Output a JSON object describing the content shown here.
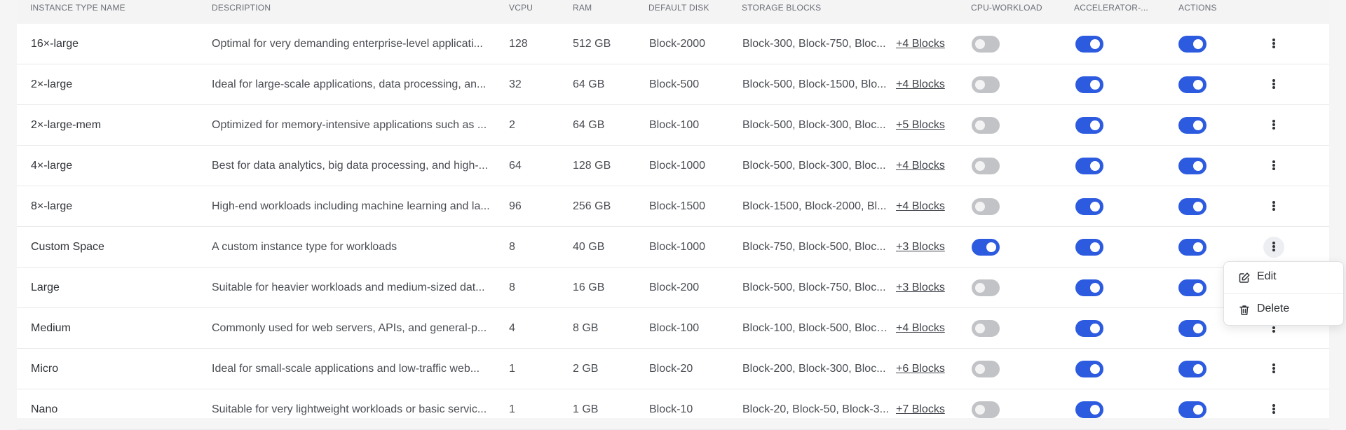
{
  "table": {
    "headers": {
      "name": "INSTANCE TYPE NAME",
      "description": "DESCRIPTION",
      "vcpu": "VCPU",
      "ram": "RAM",
      "default_disk": "DEFAULT DISK",
      "storage_blocks": "STORAGE BLOCKS",
      "cpu_workload": "CPU-WORKLOAD",
      "accelerator": "ACCELERATOR-...",
      "actions": "ACTIONS"
    },
    "rows": [
      {
        "name": "16×-large",
        "description": "Optimal for very demanding enterprise-level applicati...",
        "vcpu": "128",
        "ram": "512 GB",
        "disk": "Block-2000",
        "blocks": "Block-300, Block-750, Bloc...",
        "more": "+4 Blocks",
        "cpu": false,
        "acc": true,
        "act": true
      },
      {
        "name": "2×-large",
        "description": "Ideal for large-scale applications, data processing, an...",
        "vcpu": "32",
        "ram": "64 GB",
        "disk": "Block-500",
        "blocks": "Block-500, Block-1500, Blo...",
        "more": "+4 Blocks",
        "cpu": false,
        "acc": true,
        "act": true
      },
      {
        "name": "2×-large-mem",
        "description": "Optimized for memory-intensive applications such as ...",
        "vcpu": "2",
        "ram": "64 GB",
        "disk": "Block-100",
        "blocks": "Block-500, Block-300, Bloc...",
        "more": "+5 Blocks",
        "cpu": false,
        "acc": true,
        "act": true
      },
      {
        "name": "4×-large",
        "description": "Best for data analytics, big data processing, and high-...",
        "vcpu": "64",
        "ram": "128 GB",
        "disk": "Block-1000",
        "blocks": "Block-500, Block-300, Bloc...",
        "more": "+4 Blocks",
        "cpu": false,
        "acc": true,
        "act": true
      },
      {
        "name": "8×-large",
        "description": "High-end workloads including machine learning and la...",
        "vcpu": "96",
        "ram": "256 GB",
        "disk": "Block-1500",
        "blocks": "Block-1500, Block-2000, Bl...",
        "more": "+4 Blocks",
        "cpu": false,
        "acc": true,
        "act": true
      },
      {
        "name": "Custom Space",
        "description": "A custom instance type for workloads",
        "vcpu": "8",
        "ram": "40 GB",
        "disk": "Block-1000",
        "blocks": "Block-750, Block-500, Bloc...",
        "more": "+3 Blocks",
        "cpu": true,
        "acc": true,
        "act": true
      },
      {
        "name": "Large",
        "description": "Suitable for heavier workloads and medium-sized dat...",
        "vcpu": "8",
        "ram": "16 GB",
        "disk": "Block-200",
        "blocks": "Block-500, Block-750, Bloc...",
        "more": "+3 Blocks",
        "cpu": false,
        "acc": true,
        "act": true
      },
      {
        "name": "Medium",
        "description": "Commonly used for web servers, APIs, and general-p...",
        "vcpu": "4",
        "ram": "8 GB",
        "disk": "Block-100",
        "blocks": "Block-100, Block-500, Block...",
        "more": "+4 Blocks",
        "cpu": false,
        "acc": true,
        "act": true
      },
      {
        "name": "Micro",
        "description": "Ideal for small-scale applications and low-traffic web...",
        "vcpu": "1",
        "ram": "2 GB",
        "disk": "Block-20",
        "blocks": "Block-200, Block-300, Bloc...",
        "more": "+6 Blocks",
        "cpu": false,
        "acc": true,
        "act": true
      },
      {
        "name": "Nano",
        "description": "Suitable for very lightweight workloads or basic servic...",
        "vcpu": "1",
        "ram": "1 GB",
        "disk": "Block-10",
        "blocks": "Block-20, Block-50, Block-3...",
        "more": "+7 Blocks",
        "cpu": false,
        "acc": true,
        "act": true
      }
    ]
  },
  "context_menu": {
    "edit_label": "Edit",
    "delete_label": "Delete",
    "edit_icon": "edit-icon",
    "delete_icon": "trash-icon"
  },
  "colors": {
    "accent": "#2c5be0",
    "toggle_off": "#c2c3c6",
    "header_bg": "#f4f4f5"
  }
}
